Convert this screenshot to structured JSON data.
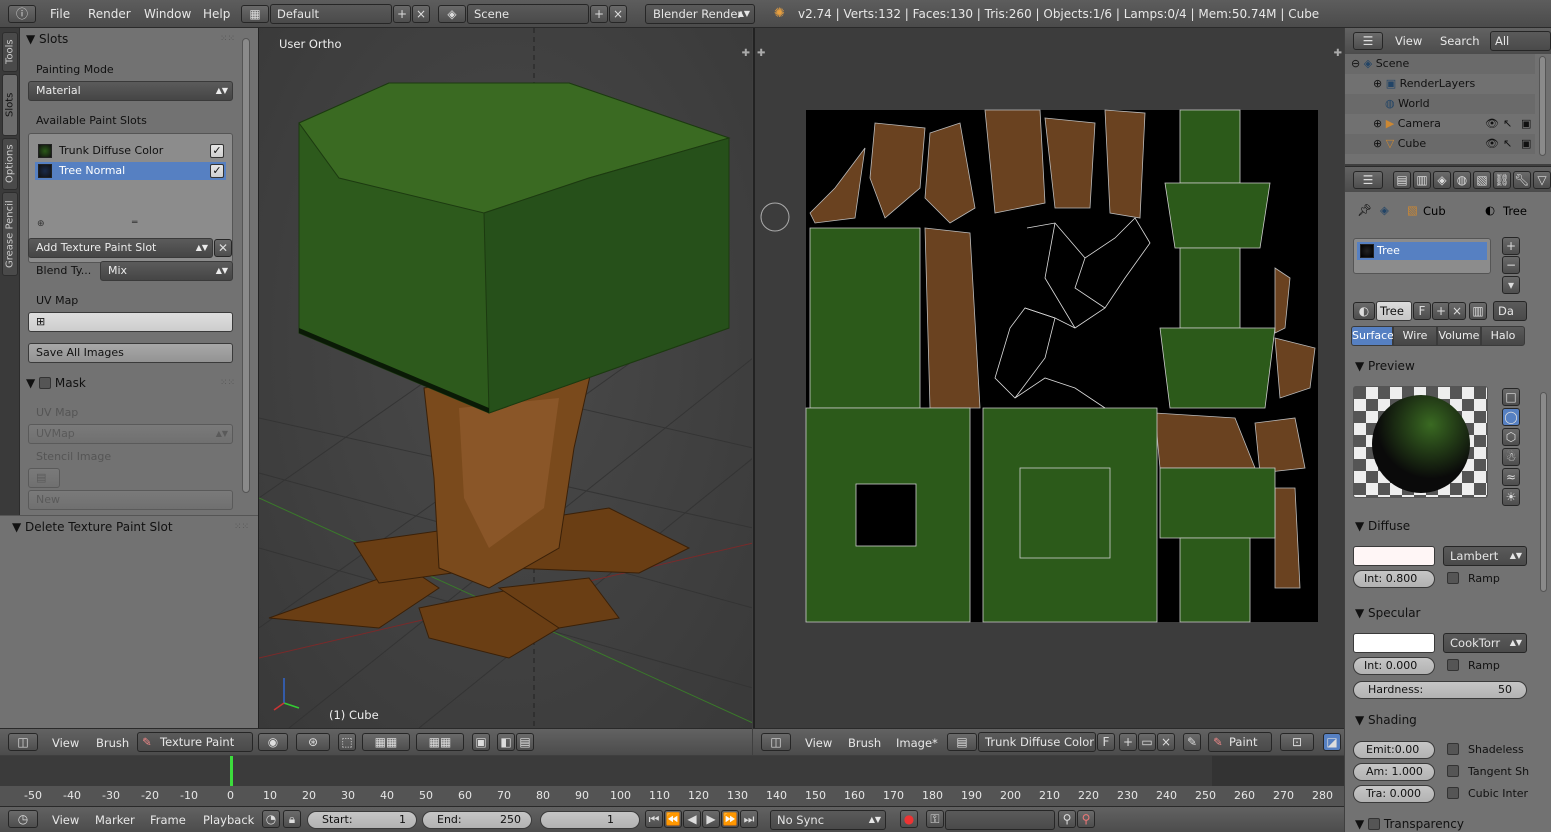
{
  "topbar": {
    "menus": [
      "File",
      "Render",
      "Window",
      "Help"
    ],
    "layout": "Default",
    "scene": "Scene",
    "engine": "Blender Render",
    "stats": "v2.74 | Verts:132 | Faces:130 | Tris:260 | Objects:1/6 | Lamps:0/4 | Mem:50.74M | Cube"
  },
  "tool_tabs": [
    "Tools",
    "Slots",
    "Options",
    "Grease Pencil"
  ],
  "slots_panel": {
    "title": "Slots",
    "painting_mode_label": "Painting Mode",
    "painting_mode_value": "Material",
    "available_label": "Available Paint Slots",
    "slots": [
      "Trunk Diffuse Color",
      "Tree Normal"
    ],
    "add_slot_label": "Add Texture Paint Slot",
    "blend_label": "Blend Ty...",
    "blend_value": "Mix",
    "uvmap_label": "UV Map",
    "save_all": "Save All Images"
  },
  "mask_panel": {
    "title": "Mask",
    "uvmap_label": "UV Map",
    "uvmap_value": "UVMap",
    "stencil_label": "Stencil Image",
    "new_label": "New"
  },
  "operator_panel": {
    "title": "Delete Texture Paint Slot"
  },
  "viewport3d": {
    "view_label": "User Ortho",
    "object_label": "(1) Cube",
    "header": {
      "view": "View",
      "brush": "Brush",
      "mode": "Texture Paint"
    }
  },
  "image_editor": {
    "header": {
      "view": "View",
      "brush": "Brush",
      "image": "Image*",
      "image_name": "Trunk Diffuse Color",
      "fake": "F",
      "mode": "Paint"
    }
  },
  "timeline": {
    "ticks": [
      "-50",
      "-40",
      "-30",
      "-20",
      "-10",
      "0",
      "10",
      "20",
      "30",
      "40",
      "50",
      "60",
      "70",
      "80",
      "90",
      "100",
      "110",
      "120",
      "130",
      "140",
      "150",
      "160",
      "170",
      "180",
      "190",
      "200",
      "210",
      "220",
      "230",
      "240",
      "250",
      "260",
      "270",
      "280"
    ],
    "current_frame_value": 0,
    "menus": [
      "View",
      "Marker",
      "Frame",
      "Playback"
    ],
    "start": "Start:",
    "start_value": "1",
    "end": "End:",
    "end_value": "250",
    "current": "1",
    "sync": "No Sync"
  },
  "outliner": {
    "header": {
      "view": "View",
      "search": "Search",
      "scenes": "All Scenes"
    },
    "items": [
      "Scene",
      "RenderLayers",
      "World",
      "Camera",
      "Cube"
    ]
  },
  "properties": {
    "breadcrumb": [
      "Cub",
      "Tree"
    ],
    "material_list": [
      "Tree"
    ],
    "material_name": "Tree",
    "fake_flag": "F",
    "data_label": "Da",
    "tabs": [
      "Surface",
      "Wire",
      "Volume",
      "Halo"
    ],
    "preview_title": "Preview",
    "diffuse": {
      "title": "Diffuse",
      "shader": "Lambert",
      "intensity": "Int: 0.800",
      "ramp": "Ramp"
    },
    "specular": {
      "title": "Specular",
      "shader": "CookTorr",
      "intensity": "Int: 0.000",
      "ramp": "Ramp",
      "hardness_label": "Hardness:",
      "hardness": "50"
    },
    "shading": {
      "title": "Shading",
      "emit": "Emit:0.00",
      "ambient": "Am: 1.000",
      "translucency": "Tra: 0.000",
      "shadeless": "Shadeless",
      "tangent": "Tangent Sh",
      "cubic": "Cubic Inter"
    },
    "transparency": {
      "title": "Transparency"
    }
  },
  "colors": {
    "selection": "#5680c2",
    "panel": "#727272",
    "header": "#555555",
    "timeline_cursor": "#3cdc3c"
  }
}
